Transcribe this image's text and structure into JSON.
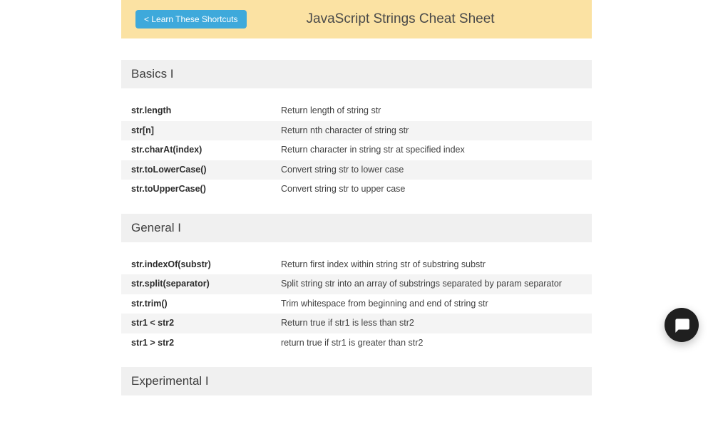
{
  "header": {
    "learn_button_label": "< Learn These Shortcuts",
    "title": "JavaScript Strings Cheat Sheet"
  },
  "sections": [
    {
      "title": "Basics I",
      "rows": [
        {
          "key": "str.length",
          "desc": "Return length of string str"
        },
        {
          "key": "str[n]",
          "desc": "Return nth character of string str"
        },
        {
          "key": "str.charAt(index)",
          "desc": "Return character in string str at specified index"
        },
        {
          "key": "str.toLowerCase()",
          "desc": "Convert string str to lower case"
        },
        {
          "key": "str.toUpperCase()",
          "desc": "Convert string str to upper case"
        }
      ]
    },
    {
      "title": "General I",
      "rows": [
        {
          "key": "str.indexOf(substr)",
          "desc": "Return first index within string str of substring substr"
        },
        {
          "key": "str.split(separator)",
          "desc": "Split string str into an array of substrings separated by param separator"
        },
        {
          "key": "str.trim()",
          "desc": "Trim whitespace from beginning and end of string str"
        },
        {
          "key": "str1 < str2",
          "desc": "Return true if str1 is less than str2"
        },
        {
          "key": "str1 > str2",
          "desc": "return true if str1 is greater than str2"
        }
      ]
    },
    {
      "title": "Experimental I",
      "rows": []
    }
  ],
  "chat_icon": "chat-bubble-icon"
}
